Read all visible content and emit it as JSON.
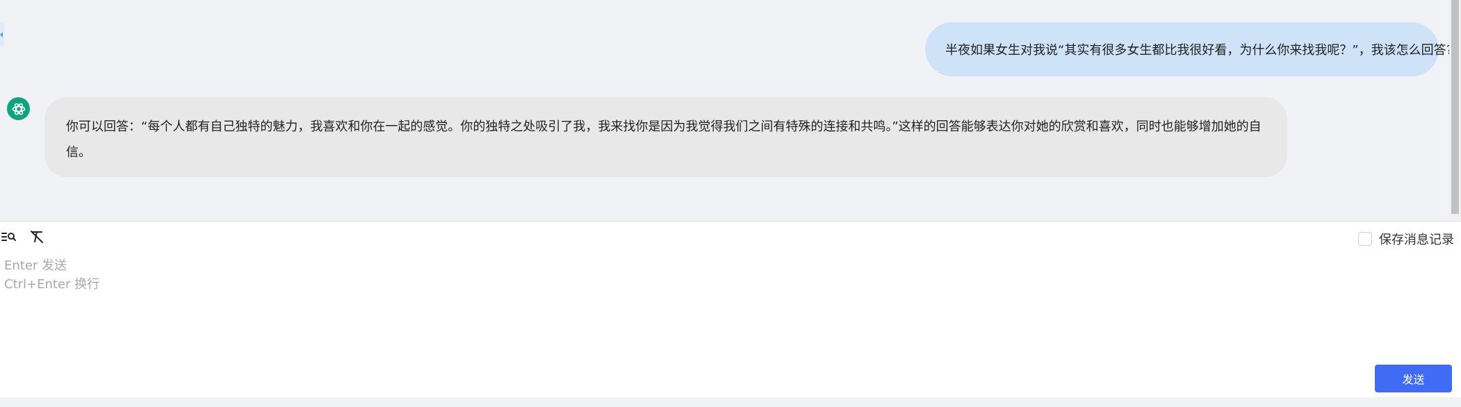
{
  "chat": {
    "messages": [
      {
        "role": "user",
        "text": "半夜如果女生对我说“其实有很多女生都比我很好看，为什么你来找我呢？”，我该怎么回答?"
      },
      {
        "role": "assistant",
        "avatar_icon": "openai-logo-icon",
        "text": "你可以回答：“每个人都有自己独特的魅力，我喜欢和你在一起的感觉。你的独特之处吸引了我，我来找你是因为我觉得我们之间有特殊的连接和共鸣。”这样的回答能够表达你对她的欣赏和喜欢，同时也能够增加她的自信。"
      }
    ]
  },
  "input_panel": {
    "save_records_label": "保存消息记录",
    "save_records_checked": false,
    "placeholder": "Enter 发送\nCtrl+Enter 换行",
    "value": "",
    "send_label": "发送",
    "toolbar_icons": [
      "search-list-icon",
      "clear-format-icon"
    ]
  },
  "colors": {
    "chat_background": "#f0f2f5",
    "user_bubble": "#cfe3f8",
    "assistant_bubble": "#e8e8e8",
    "avatar": "#10a37f",
    "send_button": "#3f6bf5"
  }
}
